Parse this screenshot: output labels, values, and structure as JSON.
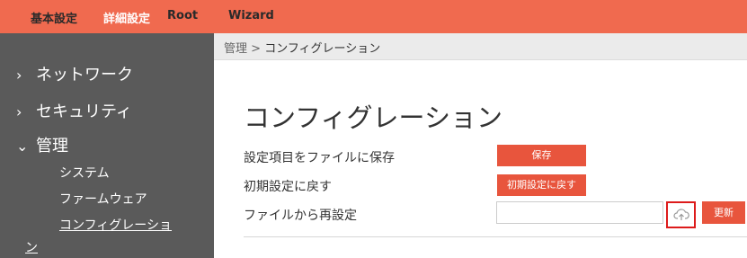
{
  "topnav": {
    "items": [
      {
        "label": "基本設定",
        "active": false
      },
      {
        "label": "詳細設定",
        "active": true
      },
      {
        "label": "Root",
        "active": false
      },
      {
        "label": "Wizard",
        "active": false
      }
    ]
  },
  "sidebar": {
    "sections": [
      {
        "label": "ネットワーク",
        "icon": "chevron-right-icon"
      },
      {
        "label": "セキュリティ",
        "icon": "chevron-right-icon"
      },
      {
        "label": "管理",
        "icon": "chevron-down-icon"
      }
    ],
    "subitems": [
      {
        "label": "システム"
      },
      {
        "label": "ファームウェア"
      },
      {
        "label": "コンフィグレーショ"
      }
    ],
    "subitem_wrap": "ン"
  },
  "breadcrumb": {
    "parent": "管理",
    "separator": ">",
    "current": "コンフィグレーション"
  },
  "page": {
    "title": "コンフィグレーション",
    "rows": [
      {
        "label": "設定項目をファイルに保存",
        "button": "保存"
      },
      {
        "label": "初期設定に戻す",
        "button": "初期設定に戻す"
      },
      {
        "label": "ファイルから再設定",
        "button": "更新",
        "upload_icon": "cloud-upload-icon"
      }
    ]
  },
  "colors": {
    "topbar": "#f06a4f",
    "sidebar": "#5a5a5a",
    "button": "#e8553d",
    "highlight": "#dd1b1b"
  }
}
